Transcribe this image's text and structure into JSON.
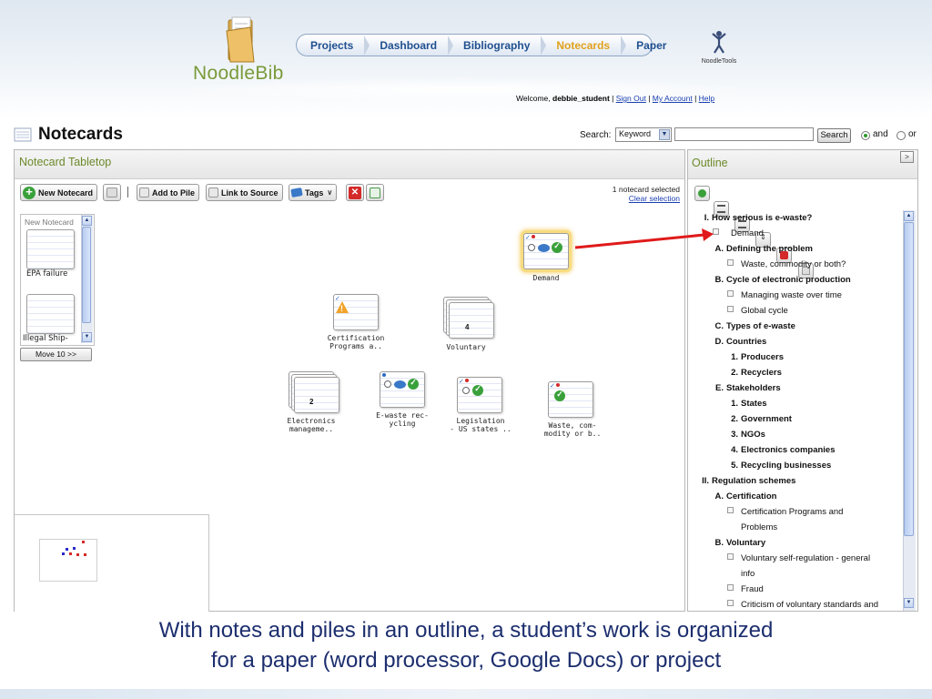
{
  "app": {
    "logo_text": "NoodleBib",
    "brand_text": "NoodleTools",
    "nav": [
      "Projects",
      "Dashboard",
      "Bibliography",
      "Notecards",
      "Paper"
    ],
    "active_nav": "Notecards",
    "welcome_prefix": "Welcome, ",
    "username": "debbie_student",
    "sign_out": "Sign Out",
    "my_account": "My Account",
    "help": "Help"
  },
  "page": {
    "title": "Notecards",
    "search": {
      "label": "Search:",
      "mode": "Keyword",
      "query": "",
      "button": "Search",
      "and_label": "and",
      "or_label": "or",
      "selected_op": "and"
    }
  },
  "tabletop": {
    "title": "Notecard Tabletop",
    "toolbar": {
      "new_notecard": "New Notecard",
      "add_to_pile": "Add to Pile",
      "link_to_source": "Link to Source",
      "tags": "Tags"
    },
    "selection_info": "1 notecard selected",
    "clear_selection": "Clear selection",
    "strip": {
      "title": "New Notecard",
      "items": [
        "EPA failure",
        "Illegal Ship-"
      ],
      "move_button": "Move 10 >>"
    },
    "cards": [
      {
        "label": "Demand",
        "selected": true
      },
      {
        "label": "Certification\nPrograms a..",
        "selected": false
      },
      {
        "label": "Voluntary",
        "pile_count": "4"
      },
      {
        "label": "Electronics\nmanageme..",
        "pile_count": "2"
      },
      {
        "label": "E-waste rec-\nycling",
        "selected": false
      },
      {
        "label": "Legislation\n- US states ..",
        "selected": false
      },
      {
        "label": "Waste, com-\nmodity or b..",
        "selected": false
      }
    ]
  },
  "outline": {
    "title": "Outline",
    "items": [
      {
        "marker": "I.",
        "text": "How serious is e-waste?",
        "bold": true,
        "level": 0
      },
      {
        "marker": "",
        "text": "Demand",
        "bold": false,
        "level": 1,
        "note": true
      },
      {
        "marker": "A.",
        "text": "Defining the problem",
        "bold": true,
        "level": 1
      },
      {
        "marker": "",
        "text": "Waste, commodity or both?",
        "bold": false,
        "level": 2,
        "note": true
      },
      {
        "marker": "B.",
        "text": "Cycle of electronic production",
        "bold": true,
        "level": 1
      },
      {
        "marker": "",
        "text": "Managing waste over time",
        "bold": false,
        "level": 2,
        "note": true
      },
      {
        "marker": "",
        "text": "Global cycle",
        "bold": false,
        "level": 2,
        "note": true
      },
      {
        "marker": "C.",
        "text": "Types of e-waste",
        "bold": true,
        "level": 1
      },
      {
        "marker": "D.",
        "text": "Countries",
        "bold": true,
        "level": 1
      },
      {
        "marker": "1.",
        "text": "Producers",
        "bold": true,
        "level": 2
      },
      {
        "marker": "2.",
        "text": "Recyclers",
        "bold": true,
        "level": 2
      },
      {
        "marker": "E.",
        "text": "Stakeholders",
        "bold": true,
        "level": 1
      },
      {
        "marker": "1.",
        "text": "States",
        "bold": true,
        "level": 2
      },
      {
        "marker": "2.",
        "text": "Government",
        "bold": true,
        "level": 2
      },
      {
        "marker": "3.",
        "text": "NGOs",
        "bold": true,
        "level": 2
      },
      {
        "marker": "4.",
        "text": "Electronics companies",
        "bold": true,
        "level": 2
      },
      {
        "marker": "5.",
        "text": "Recycling businesses",
        "bold": true,
        "level": 2
      },
      {
        "marker": "II.",
        "text": "Regulation schemes",
        "bold": true,
        "level": 0
      },
      {
        "marker": "A.",
        "text": "Certification",
        "bold": true,
        "level": 1
      },
      {
        "marker": "",
        "text": "Certification Programs and",
        "bold": false,
        "level": 2,
        "note": true
      },
      {
        "marker": "",
        "text": "Problems",
        "bold": false,
        "level": 2,
        "cont": true
      },
      {
        "marker": "B.",
        "text": "Voluntary",
        "bold": true,
        "level": 1
      },
      {
        "marker": "",
        "text": "Voluntary self-regulation - general",
        "bold": false,
        "level": 2,
        "note": true
      },
      {
        "marker": "",
        "text": "info",
        "bold": false,
        "level": 2,
        "cont": true
      },
      {
        "marker": "",
        "text": "Fraud",
        "bold": false,
        "level": 2,
        "note": true
      },
      {
        "marker": "",
        "text": "Criticism of voluntary standards and",
        "bold": false,
        "level": 2,
        "note": true
      }
    ]
  },
  "caption": {
    "line1": "With notes and piles in an outline, a student’s work is organized",
    "line2": "for a paper (word processor, Google Docs) or project"
  },
  "colors": {
    "accent_green": "#6c8a2a",
    "nav_blue": "#1f4f8f",
    "nav_active": "#e1a21a",
    "caption_blue": "#1c2e6e",
    "arrow_red": "#e01a1a"
  }
}
